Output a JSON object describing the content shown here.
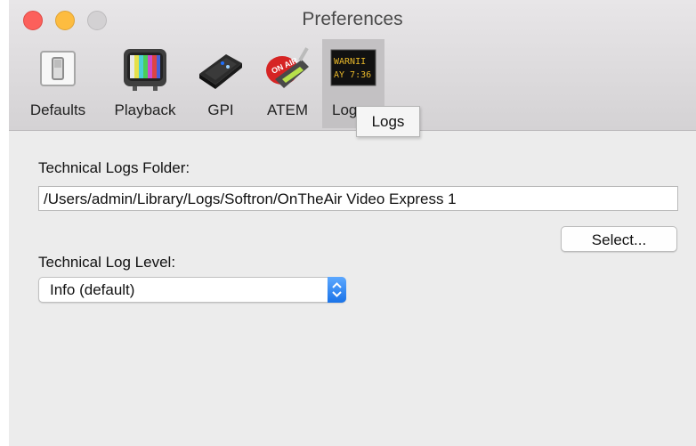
{
  "window": {
    "title": "Preferences"
  },
  "toolbar": {
    "items": [
      {
        "label": "Defaults",
        "icon": "switch-icon"
      },
      {
        "label": "Playback",
        "icon": "tv-color-bars-icon"
      },
      {
        "label": "GPI",
        "icon": "gpi-device-icon"
      },
      {
        "label": "ATEM",
        "icon": "atem-on-air-icon"
      },
      {
        "label": "Logs",
        "icon": "warning-sign-icon",
        "selected": true,
        "icon_text_lines": [
          "WARNII",
          "AY 7:36"
        ]
      }
    ],
    "tooltip": "Logs"
  },
  "logs": {
    "folder_label": "Technical Logs Folder:",
    "folder_value": "/Users/admin/Library/Logs/Softron/OnTheAir Video Express 1",
    "select_button": "Select...",
    "level_label": "Technical Log Level:",
    "level_value": "Info (default)"
  },
  "colors": {
    "close": "#fc605b",
    "minimize": "#fdbc40",
    "zoom_disabled": "#d3d1d3",
    "accent": "#1a73e8"
  }
}
